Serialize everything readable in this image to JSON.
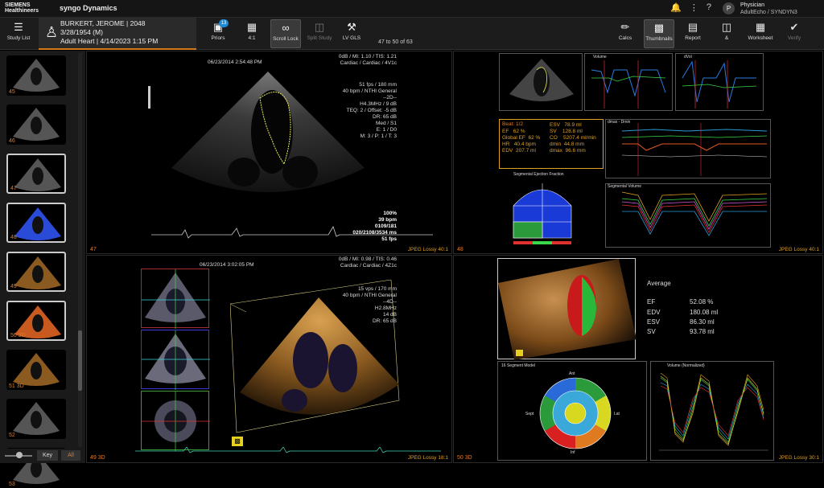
{
  "header": {
    "brand_line1": "SIEMENS",
    "brand_line2": "Healthineers",
    "product": "syngo Dynamics"
  },
  "user": {
    "initial": "P",
    "role": "Physician",
    "workspace": "AdultEcho / SYNDYN3"
  },
  "toolbar": {
    "study_list": "Study List",
    "patient": {
      "name": "BURKERT, JEROME | 2048",
      "dob": "3/28/1954 (M)",
      "study": "Adult Heart | 4/14/2023 1:15 PM"
    },
    "priors": "Priors",
    "priors_badge": "13",
    "layout": "4:1",
    "scroll_lock": "Scroll Lock",
    "split_study": "Split Study",
    "lv_gls": "LV GLS",
    "image_count": "47 to 50 of 63",
    "calcs": "Calcs",
    "thumbnails": "Thumbnails",
    "report": "Report",
    "amp": "&",
    "worksheet": "Worksheet",
    "verify": "Verify"
  },
  "thumbnails": [
    {
      "label": "45",
      "selected": false
    },
    {
      "label": "46",
      "selected": false
    },
    {
      "label": "47",
      "selected": true
    },
    {
      "label": "48",
      "selected": true
    },
    {
      "label": "49",
      "selected": true
    },
    {
      "label": "50 3D",
      "selected": true
    },
    {
      "label": "51 3D",
      "selected": false
    },
    {
      "label": "52",
      "selected": false
    },
    {
      "label": "53",
      "selected": false
    }
  ],
  "sidebar_footer": {
    "key": "Key",
    "all": "All"
  },
  "vp1": {
    "timestamp": "06/23/2014 2:54:48 PM",
    "top_right": "0dB / MI: 1.10 / TIS: 1.21\nCardiac / Cardiac / 4V1c",
    "params": "51 fps / 180 mm\n40 bpm / NTHI General\n--2D--\nH4.3MHz / 9 dB\nTEQ: 2 / Offset: -5 dB\nDR: 65 dB\nMed / S1\nE: 1 / D0\nM: 3 / P: 1 / T: 3",
    "bottom_right": "100%\n39 bpm\n0109/181\n020/2108/3534 ms\n51 fps",
    "number": "47",
    "compression": "JPEG Lossy 40:1"
  },
  "vp2": {
    "number": "48",
    "beat": "Beat: 1/2",
    "left_stats": "EF   62 %\nGlobal EF  62 %\nHR   40.4 bpm\nEDV  207.7 ml",
    "right_stats": "ESV   78.9 ml\nSV    128.8 ml\nCO    5207.4 ml/min\ndmin  44.8 mm\ndmax  96.6 mm",
    "graph1_title": "Volume",
    "graph2_title": "dVol",
    "graph3_title": "dmax - Dmin",
    "graph4_title": "Segmental Volume",
    "sef_title": "Segmental Ejection Fraction",
    "compression": "JPEG Lossy 40:1"
  },
  "vp3": {
    "timestamp": "06/23/2014 3:02:05 PM",
    "top_right": "0dB / MI: 0.98 / TIS: 0.46\nCardiac / Cardiac / 4Z1c",
    "params": "15 vps / 170 mm\n40 bpm / NTHI General\n--4D--\nH2.8MHz\n14 dB\nDR: 65 dB",
    "number": "49 3D",
    "compression": "JPEG Lossy 18:1"
  },
  "vp4": {
    "number": "50 3D",
    "avg_title": "Average",
    "stats": [
      {
        "label": "EF",
        "value": "52.08 %"
      },
      {
        "label": "EDV",
        "value": "180.08 ml"
      },
      {
        "label": "ESV",
        "value": "86.30 ml"
      },
      {
        "label": "SV",
        "value": "93.78 ml"
      }
    ],
    "bullseye_title": "16 Segment Model",
    "bullseye_labels": {
      "ant": "Ant",
      "sept": "Sept",
      "lat": "Lat",
      "inf": "Inf"
    },
    "volume_title": "Volume (Normalized)",
    "compression": "JPEG Lossy 30:1"
  },
  "colors": {
    "accent": "#e07a20",
    "trace": "#e8e85a",
    "bullseye_blue": "#1a3ad8",
    "bullseye_green": "#2a9a3a"
  }
}
